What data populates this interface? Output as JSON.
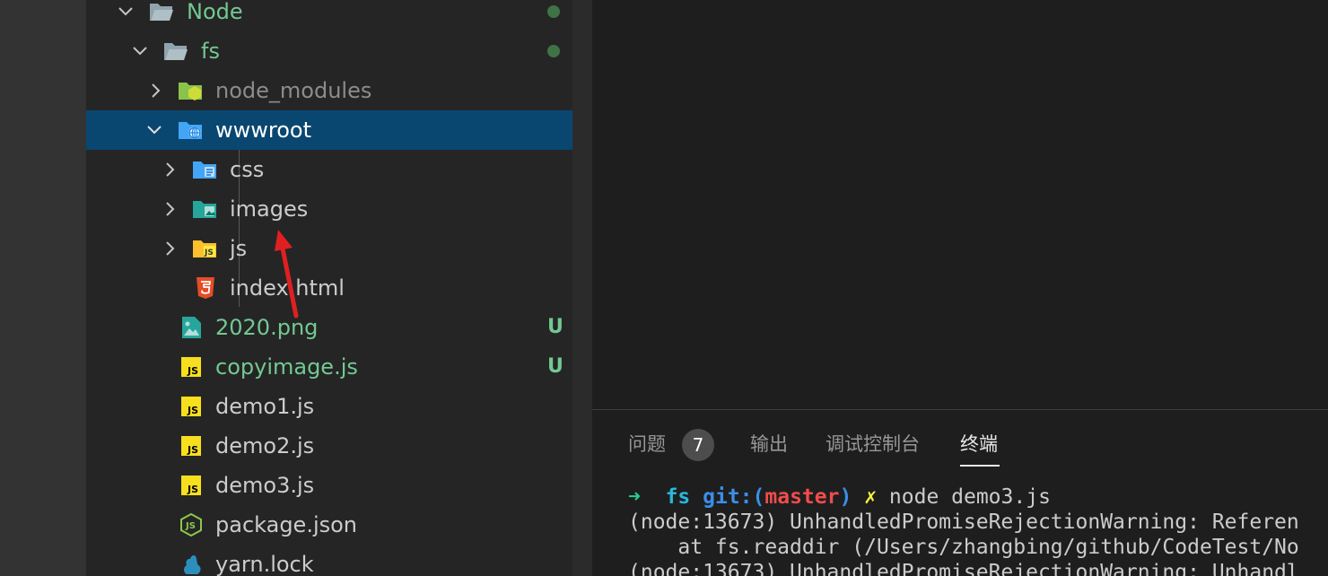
{
  "explorer": {
    "items": [
      {
        "label": "Node",
        "icon": "folder-open-icon",
        "chevron": "down",
        "status": "dot"
      },
      {
        "label": "fs",
        "icon": "folder-open-icon",
        "chevron": "down",
        "status": "dot"
      },
      {
        "label": "node_modules",
        "icon": "node-folder-icon",
        "chevron": "right"
      },
      {
        "label": "wwwroot",
        "icon": "web-folder-icon",
        "chevron": "down",
        "selected": true
      },
      {
        "label": "css",
        "icon": "css-folder-icon",
        "chevron": "right"
      },
      {
        "label": "images",
        "icon": "images-folder-icon",
        "chevron": "right"
      },
      {
        "label": "js",
        "icon": "js-folder-icon",
        "chevron": "right"
      },
      {
        "label": "index.html",
        "icon": "html5-icon"
      },
      {
        "label": "2020.png",
        "icon": "image-file-icon",
        "status": "U"
      },
      {
        "label": "copyimage.js",
        "icon": "js-file-icon",
        "status": "U"
      },
      {
        "label": "demo1.js",
        "icon": "js-file-icon"
      },
      {
        "label": "demo2.js",
        "icon": "js-file-icon"
      },
      {
        "label": "demo3.js",
        "icon": "js-file-icon"
      },
      {
        "label": "package.json",
        "icon": "nodejs-icon"
      },
      {
        "label": "yarn.lock",
        "icon": "yarn-icon"
      }
    ]
  },
  "panel": {
    "tabs": [
      {
        "label": "问题",
        "count": "7"
      },
      {
        "label": "输出"
      },
      {
        "label": "调试控制台"
      },
      {
        "label": "终端",
        "active": true
      }
    ]
  },
  "terminal": {
    "prompt_arrow": "➜",
    "dir": "fs",
    "git_label": "git:(",
    "branch": "master",
    "git_close": ")",
    "dirty_mark": "✗",
    "command": "node demo3.js",
    "lines": [
      "(node:13673) UnhandledPromiseRejectionWarning: Referen",
      "    at fs.readdir (/Users/zhangbing/github/CodeTest/No",
      "(node:13673) UnhandledPromiseRejectionWarning: Unhandl"
    ]
  },
  "colors": {
    "selection": "#094771",
    "untracked": "#73c991",
    "annotation_arrow": "#e02020"
  }
}
